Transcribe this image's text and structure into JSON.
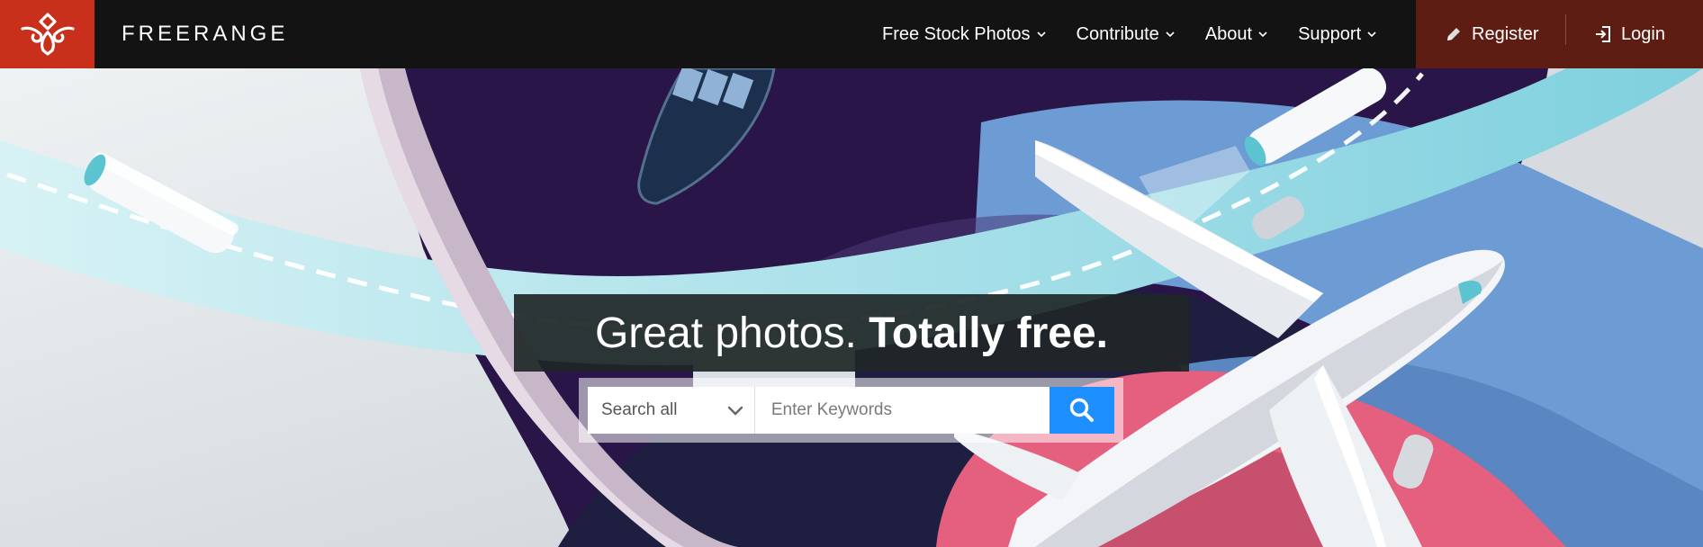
{
  "brand": {
    "name": "FREERANGE",
    "logo_icon": "freerange-leaf-logo",
    "accent_color": "#c9301c"
  },
  "nav": {
    "items": [
      {
        "label": "Free Stock Photos",
        "icon": "chevron-down-icon"
      },
      {
        "label": "Contribute",
        "icon": "chevron-down-icon"
      },
      {
        "label": "About",
        "icon": "chevron-down-icon"
      },
      {
        "label": "Support",
        "icon": "chevron-down-icon"
      }
    ]
  },
  "auth": {
    "register_label": "Register",
    "register_icon": "pencil-icon",
    "login_label": "Login",
    "login_icon": "sign-in-icon",
    "background_color": "#5e1d12"
  },
  "hero": {
    "headline_light": "Great photos.",
    "headline_bold": "Totally free."
  },
  "search": {
    "scope_selected": "Search all",
    "placeholder": "Enter Keywords",
    "value": "",
    "button_icon": "search-icon",
    "button_color": "#1e8fff"
  }
}
